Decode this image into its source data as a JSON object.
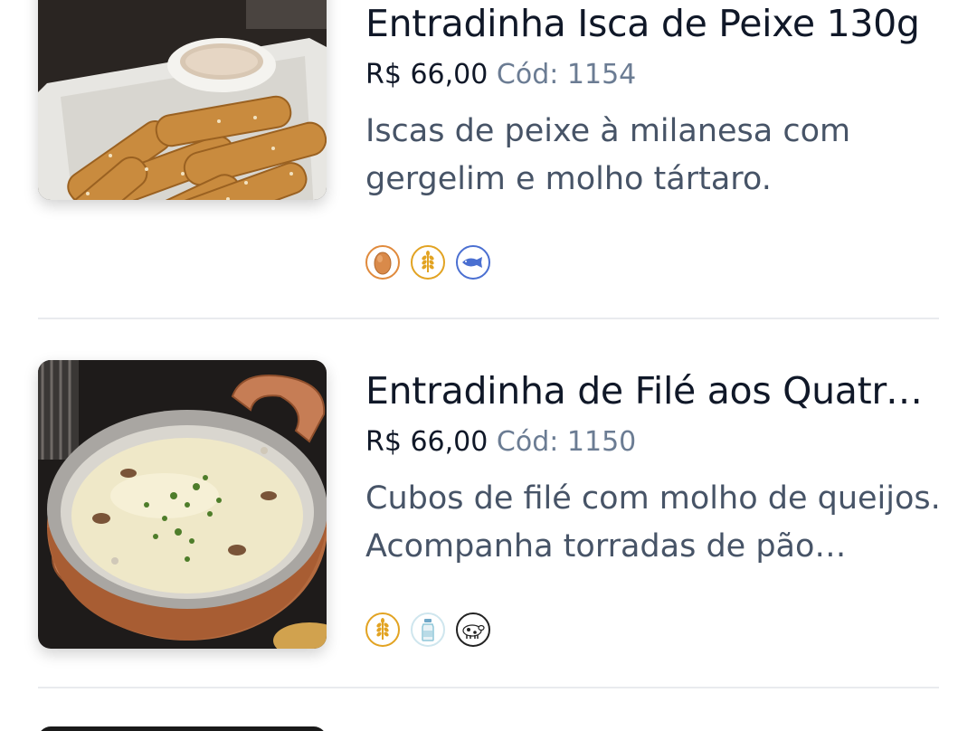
{
  "items": [
    {
      "title": "Entradinha Isca de Peixe 130g",
      "price": "R$ 66,00",
      "code_label": "Cód:",
      "code_value": "1154",
      "description": "Iscas de peixe à milanesa com gergelim e molho tártaro.",
      "allergens": [
        "egg-icon",
        "gluten-wheat-icon",
        "fish-icon"
      ],
      "image": "fried-fish-strips-photo"
    },
    {
      "title": "Entradinha de Filé aos Quatro Queijos",
      "price": "R$ 66,00",
      "code_label": "Cód:",
      "code_value": "1150",
      "description": "Cubos de filé com molho de queijos. Acompanha torradas de pão italiano.",
      "allergens": [
        "gluten-wheat-icon",
        "milk-bottle-icon",
        "cow-icon"
      ],
      "image": "copper-pan-cheese-sauce-photo"
    }
  ],
  "colors": {
    "egg": "#e08a3c",
    "wheat": "#e2a322",
    "fish": "#4a6fd1",
    "milk": "#8fc7d9",
    "cow": "#222222"
  }
}
